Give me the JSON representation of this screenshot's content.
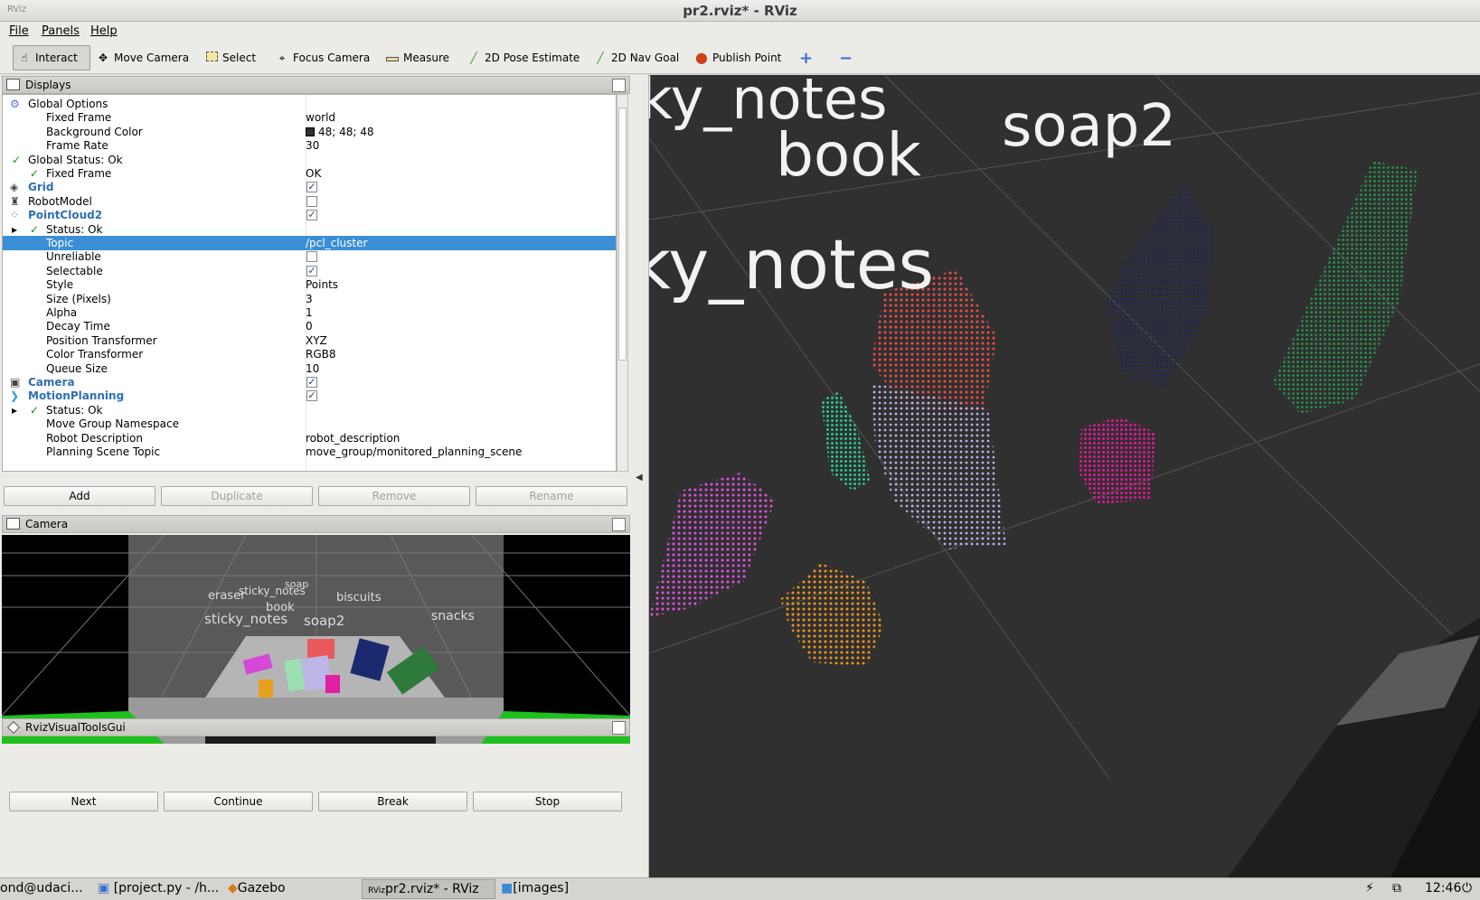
{
  "window": {
    "title": "pr2.rviz* - RViz",
    "app_icon": "RViz"
  },
  "menu": [
    "File",
    "Panels",
    "Help"
  ],
  "toolbar": {
    "interact": "Interact",
    "move_camera": "Move Camera",
    "select": "Select",
    "focus_camera": "Focus Camera",
    "measure": "Measure",
    "pose_estimate": "2D Pose Estimate",
    "nav_goal": "2D Nav Goal",
    "publish_point": "Publish Point"
  },
  "displays": {
    "title": "Displays",
    "rows": [
      {
        "key": "Global Options",
        "value": ""
      },
      {
        "key": "Fixed Frame",
        "value": "world"
      },
      {
        "key": "Background Color",
        "value": "48; 48; 48"
      },
      {
        "key": "Frame Rate",
        "value": "30"
      },
      {
        "key": "Global Status: Ok",
        "value": ""
      },
      {
        "key": "Fixed Frame",
        "value": "OK"
      },
      {
        "key": "Grid",
        "value": ""
      },
      {
        "key": "RobotModel",
        "value": ""
      },
      {
        "key": "PointCloud2",
        "value": ""
      },
      {
        "key": "Status: Ok",
        "value": ""
      },
      {
        "key": "Topic",
        "value": "/pcl_cluster"
      },
      {
        "key": "Unreliable",
        "value": ""
      },
      {
        "key": "Selectable",
        "value": ""
      },
      {
        "key": "Style",
        "value": "Points"
      },
      {
        "key": "Size (Pixels)",
        "value": "3"
      },
      {
        "key": "Alpha",
        "value": "1"
      },
      {
        "key": "Decay Time",
        "value": "0"
      },
      {
        "key": "Position Transformer",
        "value": "XYZ"
      },
      {
        "key": "Color Transformer",
        "value": "RGB8"
      },
      {
        "key": "Queue Size",
        "value": "10"
      },
      {
        "key": "Camera",
        "value": ""
      },
      {
        "key": "MotionPlanning",
        "value": ""
      },
      {
        "key": "Status: Ok",
        "value": ""
      },
      {
        "key": "Move Group Namespace",
        "value": ""
      },
      {
        "key": "Robot Description",
        "value": "robot_description"
      },
      {
        "key": "Planning Scene Topic",
        "value": "move_group/monitored_planning_scene"
      }
    ],
    "buttons": [
      "Add",
      "Duplicate",
      "Remove",
      "Rename"
    ]
  },
  "camera_panel": {
    "title": "Camera",
    "labels": [
      "eraser",
      "sticky_notes",
      "soap",
      "biscuits",
      "sticky_notes",
      "book",
      "soap2",
      "snacks"
    ]
  },
  "visual_tools": {
    "title": "RvizVisualToolsGui",
    "buttons": [
      "Next",
      "Continue",
      "Break",
      "Stop"
    ]
  },
  "viewport": {
    "labels": [
      "ky_notes",
      "book",
      "soap2",
      "ky_notes"
    ],
    "colors": {
      "background": "#303030"
    }
  },
  "taskbar": {
    "items": [
      "ond@udaci...",
      "[project.py - /h...",
      "Gazebo",
      "pr2.rviz* - RViz",
      "[images]"
    ],
    "clock": "12:46"
  }
}
